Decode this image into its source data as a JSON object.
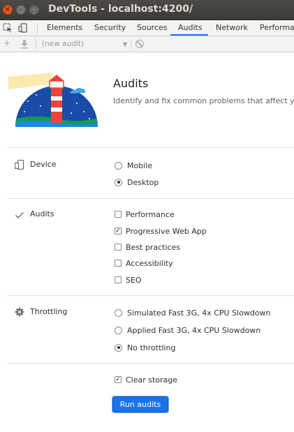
{
  "window": {
    "title": "DevTools - localhost:4200/"
  },
  "tabs": [
    {
      "label": "Elements"
    },
    {
      "label": "Security"
    },
    {
      "label": "Sources"
    },
    {
      "label": "Audits"
    },
    {
      "label": "Network"
    },
    {
      "label": "Performan"
    }
  ],
  "active_tab": "Audits",
  "toolbar": {
    "audit_select_value": "(new audit)"
  },
  "header": {
    "title": "Audits",
    "subtitle": "Identify and fix common problems that affect your"
  },
  "sections": {
    "device": {
      "label": "Device",
      "options": [
        {
          "label": "Mobile",
          "selected": false
        },
        {
          "label": "Desktop",
          "selected": true
        }
      ]
    },
    "audits": {
      "label": "Audits",
      "options": [
        {
          "label": "Performance",
          "checked": false
        },
        {
          "label": "Progressive Web App",
          "checked": true
        },
        {
          "label": "Best practices",
          "checked": false
        },
        {
          "label": "Accessibility",
          "checked": false
        },
        {
          "label": "SEO",
          "checked": false
        }
      ]
    },
    "throttling": {
      "label": "Throttling",
      "options": [
        {
          "label": "Simulated Fast 3G, 4x CPU Slowdown",
          "selected": false
        },
        {
          "label": "Applied Fast 3G, 4x CPU Slowdown",
          "selected": false
        },
        {
          "label": "No throttling",
          "selected": true
        }
      ]
    },
    "storage": {
      "label": "Clear storage",
      "checked": true
    }
  },
  "run_button": {
    "label": "Run audits"
  },
  "colors": {
    "accent": "#1a73e8",
    "titlebar": "#3c3b37",
    "close_button": "#e95420"
  }
}
